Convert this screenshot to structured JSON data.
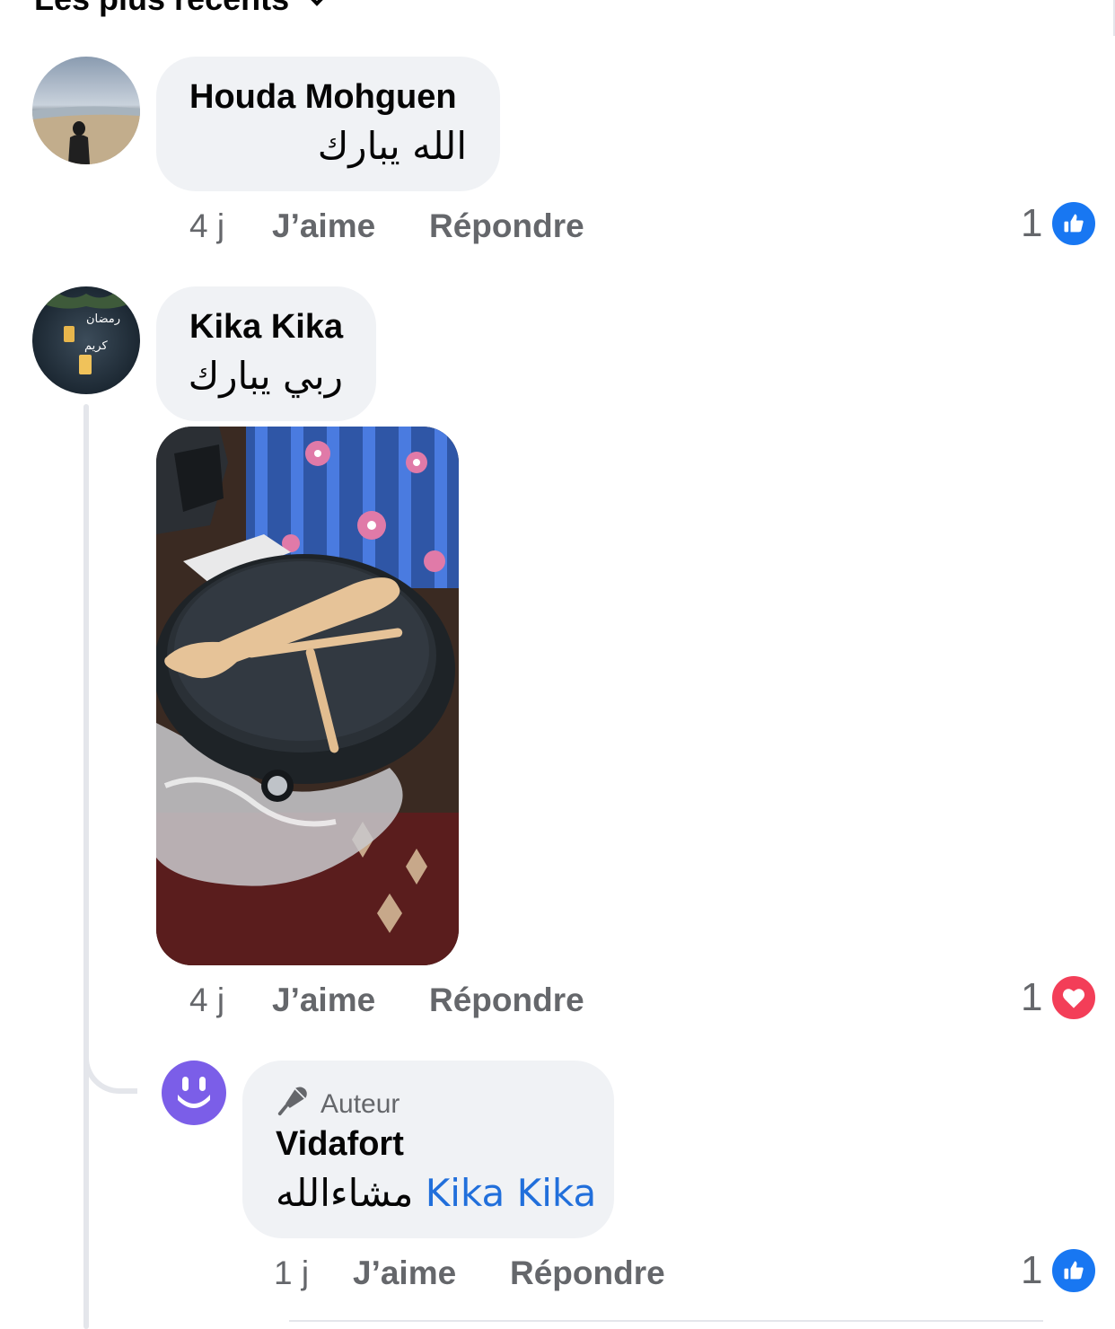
{
  "sort": {
    "label": "Les plus récents"
  },
  "comments": [
    {
      "author": "Houda Mohguen",
      "text": "الله يبارك",
      "time": "4 j",
      "like_label": "J’aime",
      "reply_label": "Répondre",
      "reaction_count": "1",
      "reaction_type": "like-icon"
    },
    {
      "author": "Kika Kika",
      "text": "ربي يبارك",
      "time": "4 j",
      "like_label": "J’aime",
      "reply_label": "Répondre",
      "reaction_count": "1",
      "reaction_type": "heart-icon",
      "reply": {
        "badge": "Auteur",
        "author": "Vidafort",
        "text": "مشاءالله",
        "mention": "Kika Kika",
        "time": "1 j",
        "like_label": "J’aime",
        "reply_label": "Répondre",
        "reaction_count": "1",
        "reaction_type": "like-icon"
      }
    }
  ],
  "colors": {
    "bubble": "#f0f2f5",
    "meta_text": "#65676b",
    "like_blue": "#1877f2",
    "love_red": "#f33e58",
    "mention_blue": "#216fdb",
    "vidafort_purple": "#7b5ee8"
  }
}
